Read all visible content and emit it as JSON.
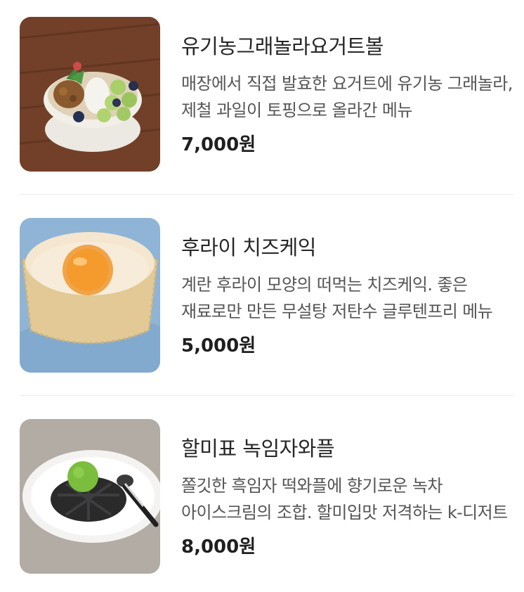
{
  "menu": {
    "items": [
      {
        "name": "유기농그래놀라요거트볼",
        "description": "매장에서 직접 발효한 요거트에 유기농 그래놀라, 제철 과일이 토핑으로 올라간 메뉴",
        "price": "7,000원",
        "image_icon": "yogurt-bowl-photo"
      },
      {
        "name": "후라이 치즈케익",
        "description": "계란 후라이 모양의 떠먹는 치즈케익. 좋은 재료로만 만든 무설탕 저탄수 글루텐프리 메뉴",
        "price": "5,000원",
        "image_icon": "cheesecake-photo"
      },
      {
        "name": "할미표 녹임자와플",
        "description": "쫄깃한 흑임자 떡와플에 향기로운 녹차 아이스크림의 조합. 할미입맛 저격하는 k-디저트",
        "price": "8,000원",
        "image_icon": "waffle-photo"
      }
    ]
  }
}
